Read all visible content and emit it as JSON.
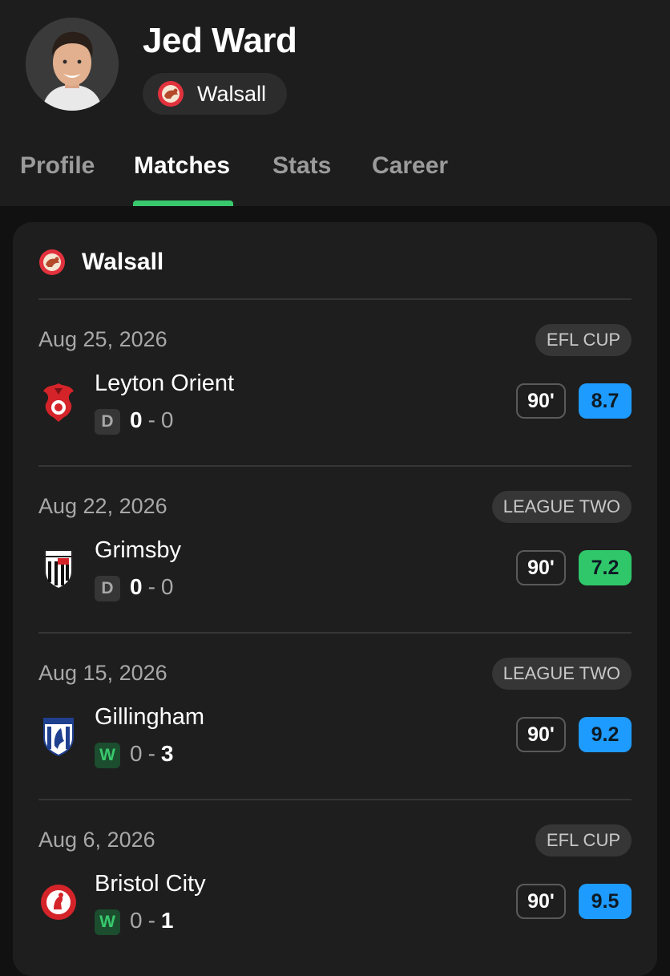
{
  "player": {
    "name": "Jed Ward",
    "team": "Walsall"
  },
  "tabs": [
    {
      "label": "Profile",
      "active": false
    },
    {
      "label": "Matches",
      "active": true
    },
    {
      "label": "Stats",
      "active": false
    },
    {
      "label": "Career",
      "active": false
    }
  ],
  "colors": {
    "accent": "#39c96d",
    "rating_blue": "#1e9bff",
    "rating_green": "#2fc76a"
  },
  "card": {
    "team": "Walsall",
    "matches": [
      {
        "date": "Aug 25, 2026",
        "competition": "EFL CUP",
        "opponent": "Leyton Orient",
        "crest_icon": "leyton-orient-crest-icon",
        "result": "D",
        "home_score": "0",
        "away_score": "0",
        "minutes": "90'",
        "rating": "8.7",
        "rating_color": "#1e9bff"
      },
      {
        "date": "Aug 22, 2026",
        "competition": "LEAGUE TWO",
        "opponent": "Grimsby",
        "crest_icon": "grimsby-crest-icon",
        "result": "D",
        "home_score": "0",
        "away_score": "0",
        "minutes": "90'",
        "rating": "7.2",
        "rating_color": "#2fc76a"
      },
      {
        "date": "Aug 15, 2026",
        "competition": "LEAGUE TWO",
        "opponent": "Gillingham",
        "crest_icon": "gillingham-crest-icon",
        "result": "W",
        "home_score": "0",
        "away_score": "3",
        "minutes": "90'",
        "rating": "9.2",
        "rating_color": "#1e9bff"
      },
      {
        "date": "Aug 6, 2026",
        "competition": "EFL CUP",
        "opponent": "Bristol City",
        "crest_icon": "bristol-city-crest-icon",
        "result": "W",
        "home_score": "0",
        "away_score": "1",
        "minutes": "90'",
        "rating": "9.5",
        "rating_color": "#1e9bff"
      }
    ]
  }
}
